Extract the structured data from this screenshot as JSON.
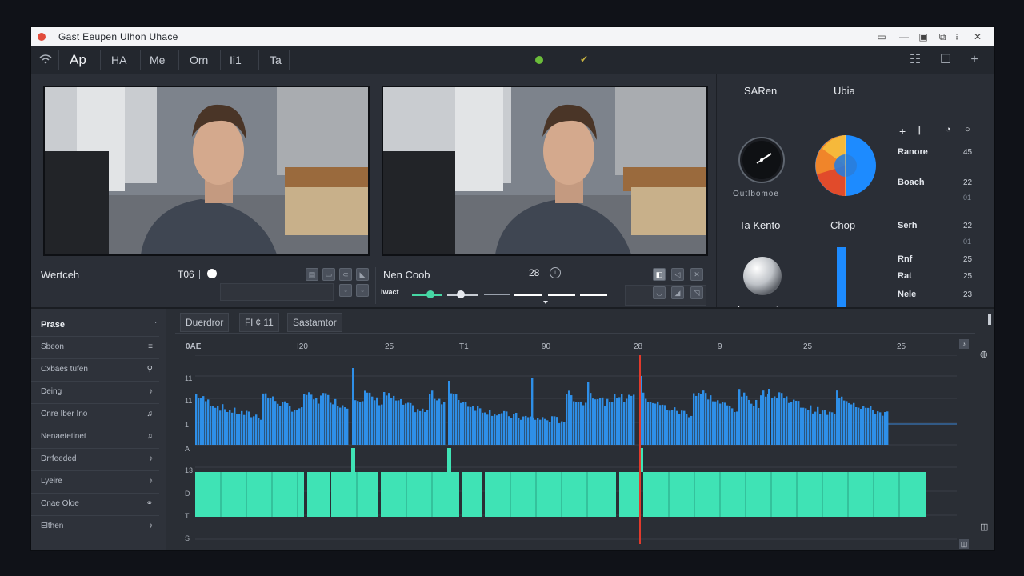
{
  "window": {
    "title": "Gast Eeupen Ulhon Uhace"
  },
  "toolbar": {
    "tabs": [
      "Ap",
      "HA",
      "Me",
      "Orn",
      "Ii1",
      "Ta"
    ]
  },
  "video_left": {
    "label": "Wertceh",
    "value": "T06"
  },
  "video_right": {
    "label": "Nen Coob",
    "value": "28",
    "slider_label": "Iwact"
  },
  "right_panel": {
    "clock_title": "SARen",
    "clock_caption": "Outlbomoe",
    "pie_title": "Ubia",
    "knob_title": "Ta Kento",
    "knob_caption": "Lom",
    "knob_caption2": "io",
    "meter_title": "Chop",
    "rows": [
      {
        "label": "Ranore",
        "value": "45"
      },
      {
        "label": "Boach",
        "value": "22"
      },
      {
        "label": "Serh",
        "value": "22"
      },
      {
        "label": "Rnf",
        "value": "25"
      },
      {
        "label": "Rat",
        "value": "25"
      },
      {
        "label": "Nele",
        "value": "23"
      }
    ],
    "subvals": [
      "01",
      "01"
    ],
    "colors": {
      "pie_orange": "#f0852a",
      "pie_blue": "#1d8bff",
      "meter": "#1d8bff"
    }
  },
  "sidebar": {
    "title": "Prase",
    "items": [
      "Sbeon",
      "Cxbaes tufen",
      "Deing",
      "Cnre Iber Ino",
      "Nenaetetinet",
      "Drrfeeded",
      "Lyeire",
      "Cnae Oloe",
      "Elthen"
    ]
  },
  "timeline": {
    "tabs": [
      "Duerdror",
      "Fl ¢ 11",
      "Sastamtor"
    ],
    "ruler": [
      "0AE",
      "I20",
      "25",
      "T1",
      "90",
      "28",
      "9",
      "25",
      "25"
    ],
    "row_labels": [
      "11",
      "11",
      "1",
      "A",
      "13",
      "D",
      "T",
      "S"
    ],
    "colors": {
      "waveform": "#2e8fe8",
      "clips": "#3fe3b5",
      "playhead": "#e23a2c"
    }
  }
}
